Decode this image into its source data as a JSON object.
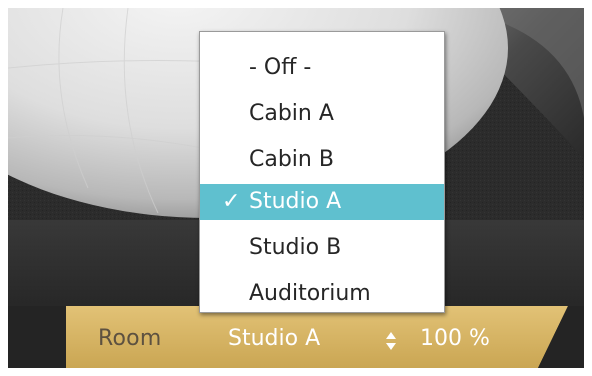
{
  "room_panel": {
    "label": "Room",
    "value": "Studio A",
    "percent": "100 %"
  },
  "dropdown": {
    "items": [
      {
        "label": "- Off -",
        "selected": false
      },
      {
        "label": "Cabin A",
        "selected": false
      },
      {
        "label": "Cabin B",
        "selected": false
      },
      {
        "label": "Studio A",
        "selected": true
      },
      {
        "label": "Studio B",
        "selected": false
      },
      {
        "label": "Auditorium",
        "selected": false
      }
    ],
    "check_glyph": "✓"
  },
  "icons": {
    "check": "check-icon",
    "spinner": "up-down-arrows-icon"
  },
  "colors": {
    "highlight": "#5fc0cf",
    "strip": "#d9b765",
    "label_text": "#5d5140",
    "value_text": "#ffffff",
    "menu_text": "#262626",
    "background": "#2b2b2b"
  }
}
